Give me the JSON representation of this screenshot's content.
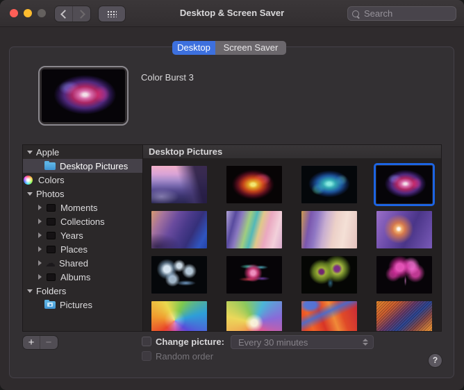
{
  "window": {
    "title": "Desktop & Screen Saver"
  },
  "toolbar": {
    "search_placeholder": "Search"
  },
  "tabs": {
    "desktop": "Desktop",
    "screen_saver": "Screen Saver",
    "selected": "Desktop"
  },
  "preview": {
    "title": "Color Burst 3"
  },
  "sidebar": {
    "groups": [
      {
        "label": "Apple",
        "items": [
          {
            "label": "Desktop Pictures",
            "icon": "blue-folder",
            "selected": true
          },
          {
            "label": "Colors",
            "icon": "color-wheel",
            "selected": false
          }
        ]
      },
      {
        "label": "Photos",
        "items": [
          {
            "label": "Moments",
            "icon": "album",
            "expandable": true
          },
          {
            "label": "Collections",
            "icon": "album",
            "expandable": true
          },
          {
            "label": "Years",
            "icon": "album",
            "expandable": true
          },
          {
            "label": "Places",
            "icon": "album",
            "expandable": true
          },
          {
            "label": "Shared",
            "icon": "cloud",
            "expandable": true
          },
          {
            "label": "Albums",
            "icon": "album",
            "expandable": true
          }
        ]
      },
      {
        "label": "Folders",
        "items": [
          {
            "label": "Pictures",
            "icon": "pictures-folder",
            "selected": false
          }
        ]
      }
    ]
  },
  "content": {
    "header": "Desktop Pictures",
    "selected_thumbnail": "Color Burst 3",
    "thumbnails": [
      {
        "name": "sierra-mountain"
      },
      {
        "name": "color-burst-red-yellow"
      },
      {
        "name": "color-burst-blue-green"
      },
      {
        "name": "color-burst-3-pink-purple",
        "selected": true
      },
      {
        "name": "abstract-purple-orange"
      },
      {
        "name": "abstract-iridescent"
      },
      {
        "name": "abstract-purple-peach"
      },
      {
        "name": "abstract-purple-copper"
      },
      {
        "name": "flowers-pale-blue"
      },
      {
        "name": "flower-pink-teal"
      },
      {
        "name": "flowers-green-purple"
      },
      {
        "name": "flowers-magenta"
      },
      {
        "name": "rainbow-swirl"
      },
      {
        "name": "rainbow-fan"
      },
      {
        "name": "red-blue-waves"
      },
      {
        "name": "orange-blue-weave"
      }
    ]
  },
  "footer": {
    "add": "+",
    "remove": "−",
    "change_picture": "Change picture:",
    "interval": "Every 30 minutes",
    "random_order": "Random order",
    "help": "?"
  },
  "colors": {
    "accent_blue": "#3d70de",
    "selection_border": "#1c64e3",
    "traffic_red": "#fe5f57",
    "traffic_yellow": "#febc2e",
    "traffic_gray": "#64605e"
  }
}
